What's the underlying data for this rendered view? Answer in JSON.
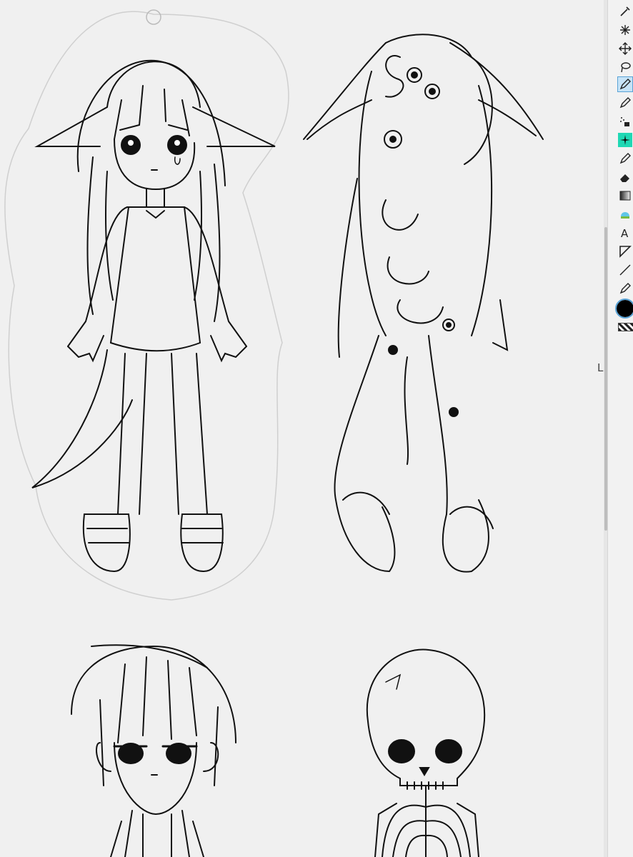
{
  "app": {
    "name": "drawing canvas"
  },
  "toolbar": {
    "tools": [
      {
        "name": "eyedropper",
        "glyph": "✒"
      },
      {
        "name": "auto-select",
        "glyph": "✳"
      },
      {
        "name": "move",
        "glyph": "✥"
      },
      {
        "name": "lasso",
        "glyph": "◌"
      },
      {
        "name": "pen",
        "glyph": "✎",
        "active": true
      },
      {
        "name": "pencil",
        "glyph": "✏"
      },
      {
        "name": "airbrush",
        "glyph": "⋰"
      },
      {
        "name": "decoration",
        "glyph": "✦",
        "highlight": true
      },
      {
        "name": "brush",
        "glyph": "✐"
      },
      {
        "name": "eraser",
        "glyph": "⌫"
      },
      {
        "name": "gradient",
        "glyph": "▦"
      },
      {
        "name": "fill",
        "glyph": "◉"
      },
      {
        "name": "text",
        "glyph": "A"
      },
      {
        "name": "ruler",
        "glyph": "◺"
      },
      {
        "name": "line",
        "glyph": "╱"
      },
      {
        "name": "correct-line",
        "glyph": "✐"
      }
    ],
    "main_color": "#000000",
    "transparent_indicator": "checker"
  },
  "side_text": "L",
  "colors": {
    "canvas_bg": "#f0f0f0",
    "ink": "#111111",
    "active_tool": "#c6e3f7",
    "highlight_tool": "#1fd8b4"
  }
}
